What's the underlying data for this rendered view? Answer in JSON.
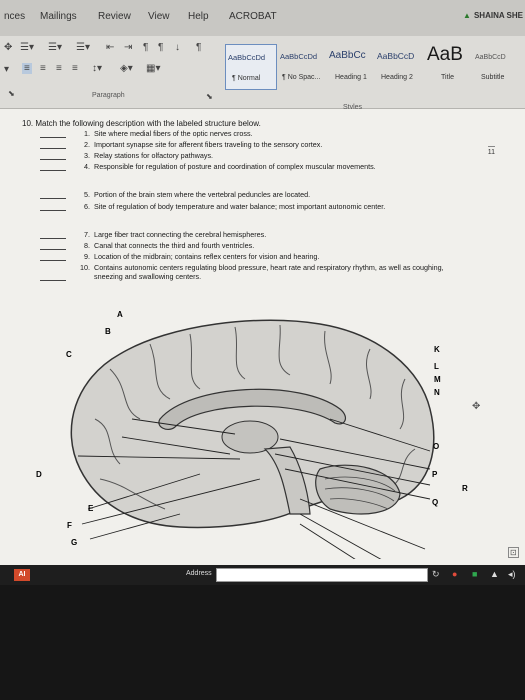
{
  "tabs": [
    "nces",
    "Mailings",
    "Review",
    "View",
    "Help",
    "ACROBAT"
  ],
  "user_name": "SHAINA SHE",
  "ribbon": {
    "paragraph_label": "Paragraph",
    "styles_label": "Styles",
    "styles": [
      {
        "preview": "AaBbCcDd",
        "name": "¶ Normal"
      },
      {
        "preview": "AaBbCcDd",
        "name": "¶ No Spac..."
      },
      {
        "preview": "AaBbCc",
        "name": "Heading 1"
      },
      {
        "preview": "AaBbCcD",
        "name": "Heading 2"
      },
      {
        "preview": "AaB",
        "name": "Title"
      },
      {
        "preview": "AaBbCcD",
        "name": "Subtitle"
      }
    ]
  },
  "document": {
    "page_number": "11",
    "question_title": "10. Match the following description with the labeled structure below.",
    "items": [
      {
        "num": "1.",
        "text": "Site where medial fibers of the optic nerves cross."
      },
      {
        "num": "2.",
        "text": "Important synapse site for afferent fibers traveling to the sensory cortex."
      },
      {
        "num": "3.",
        "text": "Relay stations for olfactory pathways."
      },
      {
        "num": "4.",
        "text": "Responsible for regulation of posture and coordination of complex muscular movements."
      },
      {
        "num": "5.",
        "text": "Portion of the brain stem where the vertebral peduncles are located."
      },
      {
        "num": "6.",
        "text": "Site of regulation of body temperature and water balance; most important autonomic center."
      },
      {
        "num": "7.",
        "text": "Large fiber tract connecting the cerebral hemispheres."
      },
      {
        "num": "8.",
        "text": "Canal that connects the third and fourth ventricles."
      },
      {
        "num": "9.",
        "text": "Location of the midbrain; contains reflex centers for vision and hearing."
      },
      {
        "num": "10.",
        "text": "Contains autonomic centers regulating blood pressure, heart rate and respiratory rhythm, as well as coughing, sneezing and swallowing centers."
      }
    ],
    "diagram_labels": {
      "A": "A",
      "B": "B",
      "C": "C",
      "D": "D",
      "E": "E",
      "F": "F",
      "G": "G",
      "K": "K",
      "L": "L",
      "M": "M",
      "N": "N",
      "O": "O",
      "P": "P",
      "Q": "Q",
      "R": "R"
    }
  },
  "taskbar": {
    "app_badge": "AI",
    "address_label": "Address"
  }
}
